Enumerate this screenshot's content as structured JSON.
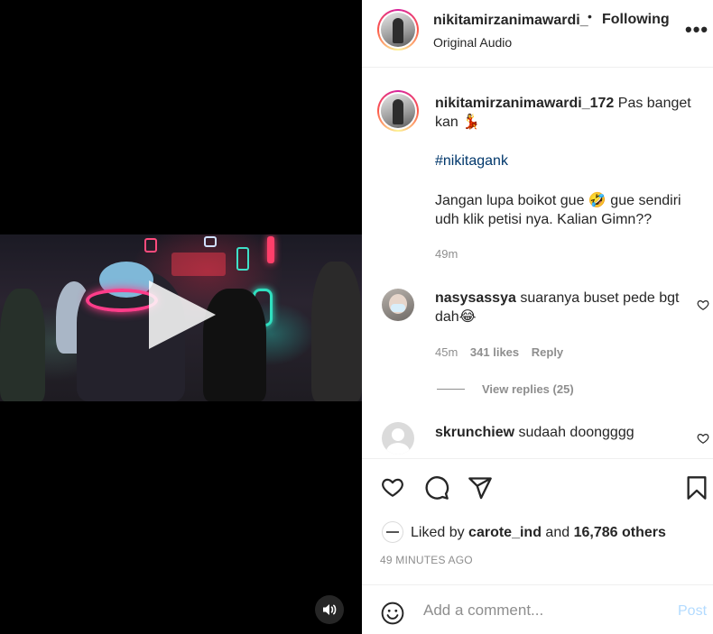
{
  "post": {
    "header": {
      "username": "nikitamirzanimawardi_",
      "separator": "•",
      "follow_status": "Following",
      "audio": "Original Audio",
      "more_icon": "more-horizontal-icon"
    },
    "caption": {
      "username": "nikitamirzanimawardi_172",
      "line1": "Pas banget",
      "line2": "kan",
      "emoji1": "💃",
      "hashtag": "#nikitagank",
      "body1": "Jangan lupa boikot gue",
      "emoji2": "🤣",
      "body2": "gue sendiri",
      "body3": "udh klik petisi nya. Kalian Gimn??",
      "time": "49m"
    },
    "comments": [
      {
        "username": "nasysassya",
        "text1": "suaranya buset pede bgt",
        "text2": "dah",
        "emoji": "😂",
        "time": "45m",
        "likes": "341 likes",
        "reply": "Reply",
        "view_replies": "View replies (25)"
      },
      {
        "username": "skrunchiew",
        "text1": "sudaah doongggg"
      }
    ],
    "actions": {
      "like_icon": "heart-icon",
      "comment_icon": "comment-icon",
      "share_icon": "send-icon",
      "save_icon": "bookmark-icon"
    },
    "likes": {
      "prefix": "Liked by",
      "user": "carote_ind",
      "middle": "and",
      "others": "16,786 others"
    },
    "timestamp": "49 MINUTES AGO",
    "add_comment": {
      "placeholder": "Add a comment...",
      "post_label": "Post",
      "emoji_icon": "smiley-icon"
    },
    "media": {
      "play_icon": "play-icon",
      "sound_icon": "speaker-icon"
    }
  }
}
